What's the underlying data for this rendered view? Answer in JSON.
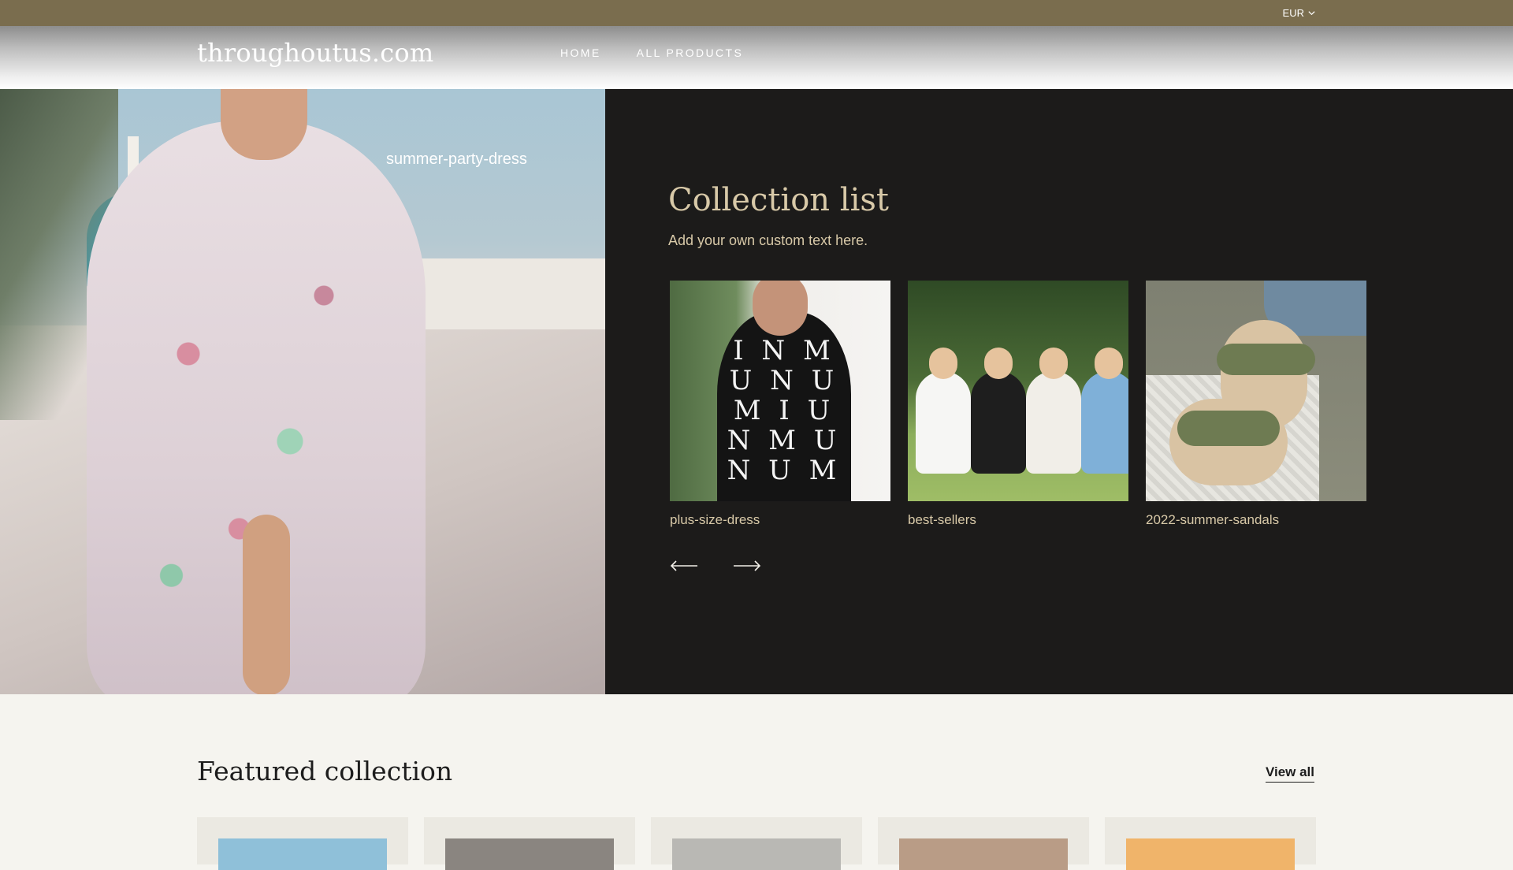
{
  "topbar": {
    "currency": "EUR"
  },
  "header": {
    "logo": "throughoutus.com",
    "nav": [
      {
        "label": "HOME"
      },
      {
        "label": "ALL PRODUCTS"
      }
    ]
  },
  "hero": {
    "image_label": "summer-party-dress",
    "collection_title": "Collection list",
    "collection_subtitle": "Add your own custom text here.",
    "collections": [
      {
        "label": "plus-size-dress"
      },
      {
        "label": "best-sellers"
      },
      {
        "label": "2022-summer-sandals"
      }
    ],
    "dress_letters": "I N M U N U M I U N M U N U M"
  },
  "featured": {
    "title": "Featured collection",
    "view_all": "View all"
  },
  "colors": {
    "topbar_bg": "#7a6d4e",
    "panel_bg": "#1c1b1a",
    "panel_text": "#d8c9a8",
    "page_bg": "#f5f4ef",
    "card_bg": "#ebe9e2"
  }
}
